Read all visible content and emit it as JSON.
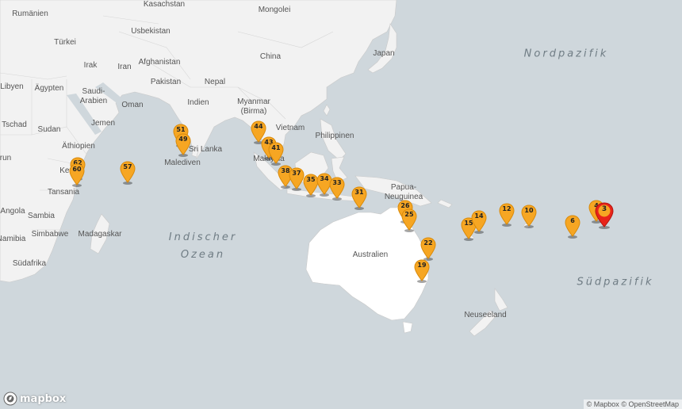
{
  "colors": {
    "water": "#cfd7dc",
    "land": "#f2f2f2",
    "australia": "#ffffff",
    "pin": "#f6a623",
    "pin_stroke": "#d98a0a",
    "active_pin": "#e8231a"
  },
  "labels": {
    "rumaenien": "Rumänien",
    "kasachstan": "Kasachstan",
    "mongolei": "Mongolei",
    "tuerkei": "Türkei",
    "usbekistan": "Usbekistan",
    "china": "China",
    "japan": "Japan",
    "irak": "Irak",
    "afghanistan": "Afghanistan",
    "iran": "Iran",
    "libyen": "Libyen",
    "aegypten": "Ägypten",
    "pakistan": "Pakistan",
    "nepal": "Nepal",
    "saudi_arabien": "Saudi-\nArabien",
    "indien": "Indien",
    "oman": "Oman",
    "myanmar": "Myanmar\n(Birma)",
    "tschad": "Tschad",
    "sudan": "Sudan",
    "jemen": "Jemen",
    "vietnam": "Vietnam",
    "philippinen": "Philippinen",
    "aethiopien": "Äthiopien",
    "sri_lanka": "Sri Lanka",
    "malediven": "Malediven",
    "malaysia": "Malaysia",
    "kenia": "Kenia",
    "tansania": "Tansania",
    "papua": "Papua-\nNeuguinea",
    "angola": "Angola",
    "sambia": "Sambia",
    "simbabwe": "Simbabwe",
    "madagaskar": "Madagaskar",
    "namibia": "Namibia",
    "australien": "Australien",
    "suedafrika": "Südafrika",
    "neuseeland": "Neuseeland",
    "run": "run"
  },
  "oceans": {
    "nordpazifik": "Nordpazifik",
    "indischer_ozean": "Indischer\nOzean",
    "suedpazifik": "Südpazifik"
  },
  "markers": [
    {
      "n": "60"
    },
    {
      "n": "62"
    },
    {
      "n": "57"
    },
    {
      "n": "51"
    },
    {
      "n": "49"
    },
    {
      "n": "44"
    },
    {
      "n": "43"
    },
    {
      "n": "41"
    },
    {
      "n": "38"
    },
    {
      "n": "37"
    },
    {
      "n": "35"
    },
    {
      "n": "34"
    },
    {
      "n": "33"
    },
    {
      "n": "31"
    },
    {
      "n": "26"
    },
    {
      "n": "25"
    },
    {
      "n": "22"
    },
    {
      "n": "19"
    },
    {
      "n": "15"
    },
    {
      "n": "14"
    },
    {
      "n": "12"
    },
    {
      "n": "10"
    },
    {
      "n": "6"
    },
    {
      "n": "4"
    },
    {
      "n": "3",
      "active": true
    }
  ],
  "footer": {
    "logo": "mapbox",
    "attr_mapbox": "© Mapbox",
    "attr_osm": "© OpenStreetMap"
  }
}
